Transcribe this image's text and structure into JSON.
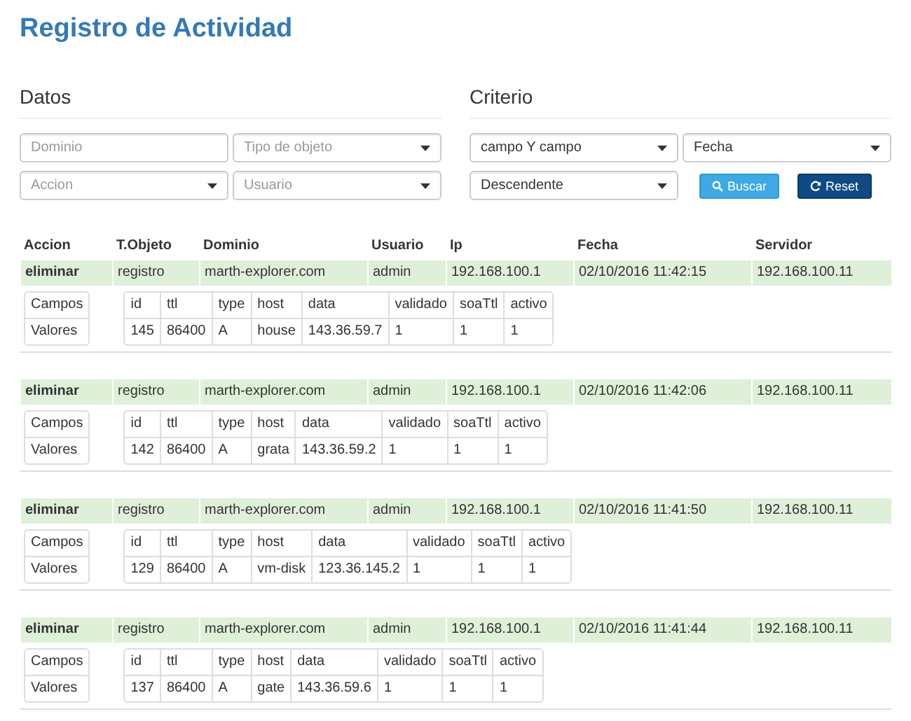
{
  "title": "Registro de Actividad",
  "datos": {
    "heading": "Datos",
    "fields": [
      {
        "kind": "input",
        "placeholder": "Dominio"
      },
      {
        "kind": "select",
        "placeholder": "Tipo de objeto"
      },
      {
        "kind": "select",
        "placeholder": "Accion"
      },
      {
        "kind": "select",
        "placeholder": "Usuario"
      }
    ]
  },
  "criterio": {
    "heading": "Criterio",
    "fields": [
      {
        "kind": "select",
        "value": "campo Y campo"
      },
      {
        "kind": "select",
        "value": "Fecha"
      },
      {
        "kind": "select",
        "value": "Descendente"
      }
    ],
    "buttons": [
      {
        "kind": "primary",
        "label": "Buscar"
      },
      {
        "kind": "dark",
        "label": "Reset"
      }
    ]
  },
  "table": {
    "columns": [
      "Accion",
      "T.Objeto",
      "Dominio",
      "Usuario",
      "Ip",
      "Fecha",
      "Servidor"
    ],
    "rows": [
      {
        "cells": [
          "eliminar",
          "registro",
          "marth-explorer.com",
          "admin",
          "192.168.100.1",
          "02/10/2016 11:42:15",
          "192.168.100.11"
        ],
        "labels": [
          "Campos",
          "Valores"
        ],
        "fields": [
          "id",
          "ttl",
          "type",
          "host",
          "data",
          "validado",
          "soaTtl",
          "activo"
        ],
        "values": [
          "145",
          "86400",
          "A",
          "house",
          "143.36.59.7",
          "1",
          "1",
          "1"
        ]
      },
      {
        "cells": [
          "eliminar",
          "registro",
          "marth-explorer.com",
          "admin",
          "192.168.100.1",
          "02/10/2016 11:42:06",
          "192.168.100.11"
        ],
        "labels": [
          "Campos",
          "Valores"
        ],
        "fields": [
          "id",
          "ttl",
          "type",
          "host",
          "data",
          "validado",
          "soaTtl",
          "activo"
        ],
        "values": [
          "142",
          "86400",
          "A",
          "grata",
          "143.36.59.2",
          "1",
          "1",
          "1"
        ]
      },
      {
        "cells": [
          "eliminar",
          "registro",
          "marth-explorer.com",
          "admin",
          "192.168.100.1",
          "02/10/2016 11:41:50",
          "192.168.100.11"
        ],
        "labels": [
          "Campos",
          "Valores"
        ],
        "fields": [
          "id",
          "ttl",
          "type",
          "host",
          "data",
          "validado",
          "soaTtl",
          "activo"
        ],
        "values": [
          "129",
          "86400",
          "A",
          "vm-disk",
          "123.36.145.2",
          "1",
          "1",
          "1"
        ]
      },
      {
        "cells": [
          "eliminar",
          "registro",
          "marth-explorer.com",
          "admin",
          "192.168.100.1",
          "02/10/2016 11:41:44",
          "192.168.100.11"
        ],
        "labels": [
          "Campos",
          "Valores"
        ],
        "fields": [
          "id",
          "ttl",
          "type",
          "host",
          "data",
          "validado",
          "soaTtl",
          "activo"
        ],
        "values": [
          "137",
          "86400",
          "A",
          "gate",
          "143.36.59.6",
          "1",
          "1",
          "1"
        ]
      }
    ]
  }
}
